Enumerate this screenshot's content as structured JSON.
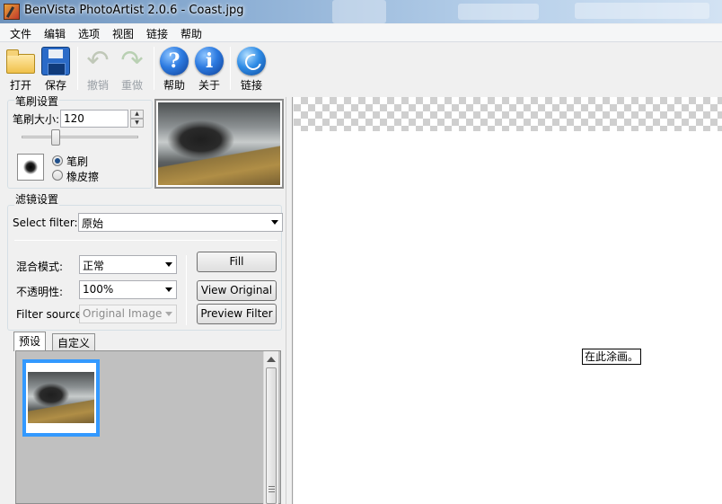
{
  "window": {
    "title": "BenVista PhotoArtist 2.0.6 - Coast.jpg"
  },
  "menu": [
    "文件",
    "编辑",
    "选项",
    "视图",
    "链接",
    "帮助"
  ],
  "toolbar": {
    "open": "打开",
    "save": "保存",
    "undo": "撤销",
    "redo": "重做",
    "help": "帮助",
    "about": "关于",
    "link": "链接",
    "help_glyph": "?",
    "about_glyph": "i"
  },
  "brush": {
    "group_title": "笔刷设置",
    "size_label": "笔刷大小:",
    "size_value": "120",
    "mode_brush": "笔刷",
    "mode_eraser": "橡皮擦",
    "selected_mode": "笔刷"
  },
  "filter": {
    "group_title": "滤镜设置",
    "select_label": "Select filter:",
    "select_value": "原始",
    "blend_label": "混合模式:",
    "blend_value": "正常",
    "opacity_label": "不透明性:",
    "opacity_value": "100%",
    "source_label": "Filter source:",
    "source_value": "Original Image",
    "fill_button": "Fill",
    "view_original_button": "View Original",
    "preview_filter_button": "Preview Filter"
  },
  "tabs": {
    "presets": "预设",
    "custom": "自定义",
    "active": "预设"
  },
  "canvas": {
    "hint": "在此涂画。"
  },
  "icons": {
    "open": "folder-icon",
    "save": "floppy-disk-icon",
    "undo": "undo-arrow-icon",
    "redo": "redo-arrow-icon",
    "help": "question-icon",
    "about": "info-icon",
    "link": "globe-icon"
  },
  "colors": {
    "selection_blue": "#3399ff",
    "title_gradient_start": "#6f93bc"
  }
}
